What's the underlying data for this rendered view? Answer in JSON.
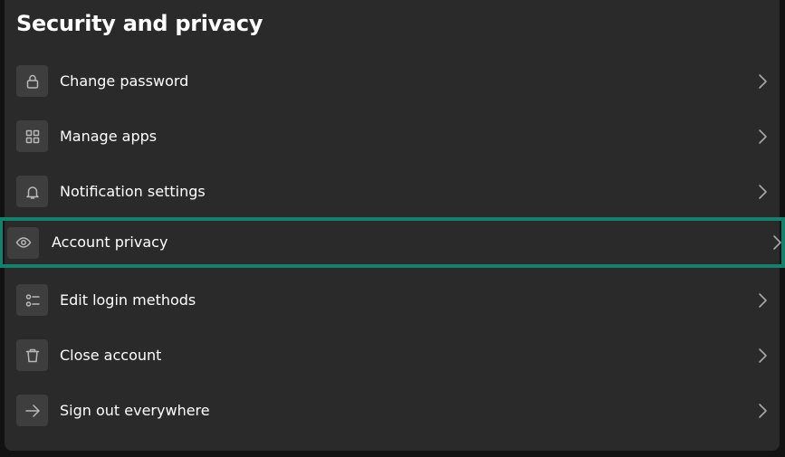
{
  "page": {
    "title": "Security and privacy"
  },
  "settings": {
    "items": [
      {
        "label": "Change password",
        "icon": "lock-icon",
        "selected": false
      },
      {
        "label": "Manage apps",
        "icon": "grid-icon",
        "selected": false
      },
      {
        "label": "Notification settings",
        "icon": "bell-icon",
        "selected": false
      },
      {
        "label": "Account privacy",
        "icon": "eye-icon",
        "selected": true
      },
      {
        "label": "Edit login methods",
        "icon": "list-options-icon",
        "selected": false
      },
      {
        "label": "Close account",
        "icon": "trash-icon",
        "selected": false
      },
      {
        "label": "Sign out everywhere",
        "icon": "arrow-right-icon",
        "selected": false
      }
    ]
  },
  "colors": {
    "background": "#121212",
    "panel": "#2a2a2a",
    "icon_box": "#3e3e3e",
    "text": "#ffffff",
    "selection_outline": "#13826d"
  }
}
